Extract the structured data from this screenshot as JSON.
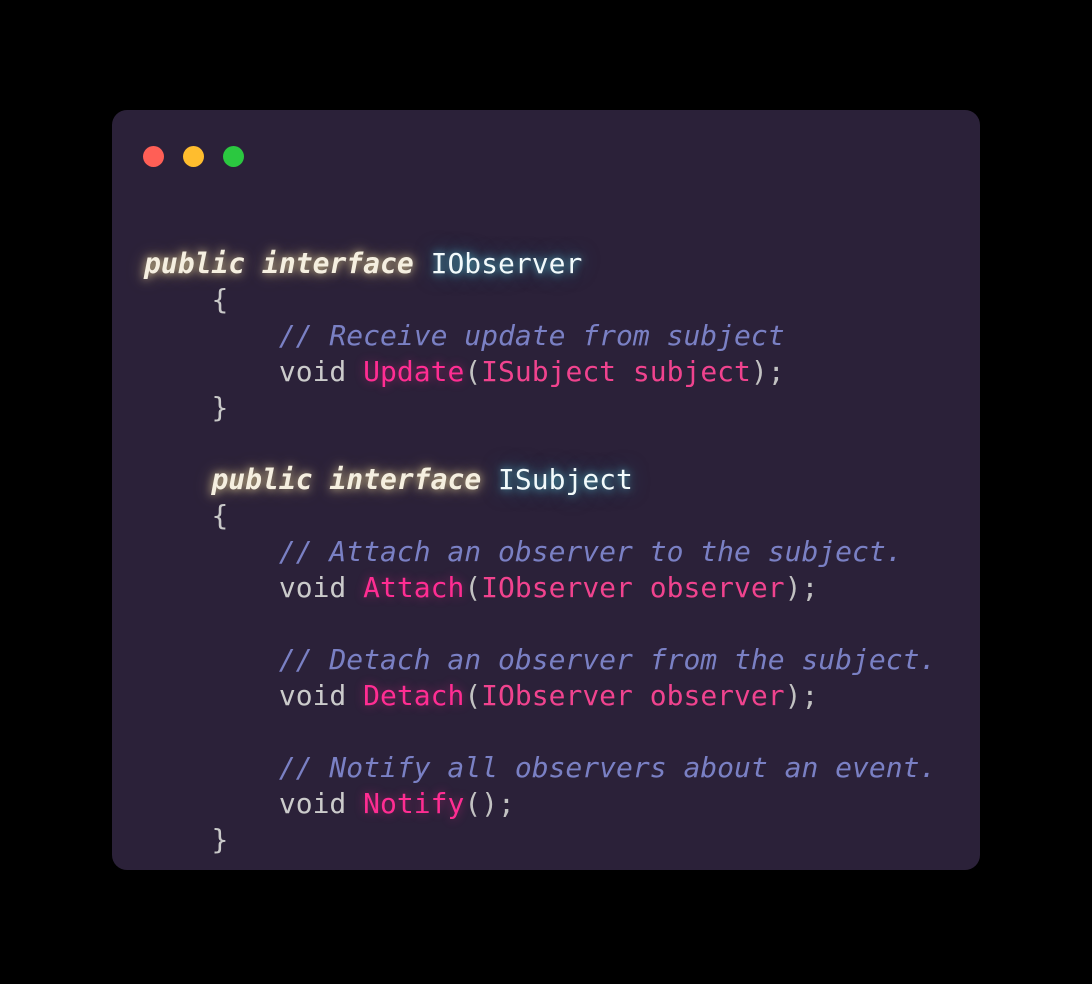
{
  "window": {
    "background_color": "#2B2139",
    "page_background_color": "#000000",
    "traffic_lights": [
      {
        "name": "close",
        "color": "#FF5F56",
        "label": ""
      },
      {
        "name": "minimize",
        "color": "#FFBD2E",
        "label": ""
      },
      {
        "name": "maximize",
        "color": "#2BC840",
        "label": ""
      }
    ]
  },
  "theme": {
    "keyword_color": "#F5EFE0",
    "type_color": "#F2FAFB",
    "comment_color": "#7A80C4",
    "plain_color": "#CBCBCB",
    "method_color": "#FF2D92",
    "param_color": "#F0438E",
    "punct_color": "#C2C2C2"
  },
  "code": {
    "language": "csharp",
    "lines": [
      {
        "n": 1,
        "indent": 0,
        "tokens": [
          {
            "t": "public",
            "k": "kw"
          },
          {
            "t": " ",
            "k": "plain"
          },
          {
            "t": "interface",
            "k": "kw"
          },
          {
            "t": " ",
            "k": "plain"
          },
          {
            "t": "IObserver",
            "k": "type"
          }
        ]
      },
      {
        "n": 2,
        "indent": 4,
        "tokens": [
          {
            "t": "{",
            "k": "brace"
          }
        ]
      },
      {
        "n": 3,
        "indent": 8,
        "tokens": [
          {
            "t": "// Receive update from subject",
            "k": "comment"
          }
        ]
      },
      {
        "n": 4,
        "indent": 8,
        "tokens": [
          {
            "t": "void",
            "k": "plain"
          },
          {
            "t": " ",
            "k": "plain"
          },
          {
            "t": "Update",
            "k": "method"
          },
          {
            "t": "(",
            "k": "punct"
          },
          {
            "t": "ISubject subject",
            "k": "param"
          },
          {
            "t": ");",
            "k": "punct"
          }
        ]
      },
      {
        "n": 5,
        "indent": 4,
        "tokens": [
          {
            "t": "}",
            "k": "brace"
          }
        ]
      },
      {
        "n": 6,
        "indent": 0,
        "tokens": []
      },
      {
        "n": 7,
        "indent": 4,
        "tokens": [
          {
            "t": "public",
            "k": "kw"
          },
          {
            "t": " ",
            "k": "plain"
          },
          {
            "t": "interface",
            "k": "kw"
          },
          {
            "t": " ",
            "k": "plain"
          },
          {
            "t": "ISubject",
            "k": "type"
          }
        ]
      },
      {
        "n": 8,
        "indent": 4,
        "tokens": [
          {
            "t": "{",
            "k": "brace"
          }
        ]
      },
      {
        "n": 9,
        "indent": 8,
        "tokens": [
          {
            "t": "// Attach an observer to the subject.",
            "k": "comment"
          }
        ]
      },
      {
        "n": 10,
        "indent": 8,
        "tokens": [
          {
            "t": "void",
            "k": "plain"
          },
          {
            "t": " ",
            "k": "plain"
          },
          {
            "t": "Attach",
            "k": "method"
          },
          {
            "t": "(",
            "k": "punct"
          },
          {
            "t": "IObserver observer",
            "k": "param"
          },
          {
            "t": ");",
            "k": "punct"
          }
        ]
      },
      {
        "n": 11,
        "indent": 0,
        "tokens": []
      },
      {
        "n": 12,
        "indent": 8,
        "tokens": [
          {
            "t": "// Detach an observer from the subject.",
            "k": "comment"
          }
        ]
      },
      {
        "n": 13,
        "indent": 8,
        "tokens": [
          {
            "t": "void",
            "k": "plain"
          },
          {
            "t": " ",
            "k": "plain"
          },
          {
            "t": "Detach",
            "k": "method"
          },
          {
            "t": "(",
            "k": "punct"
          },
          {
            "t": "IObserver observer",
            "k": "param"
          },
          {
            "t": ");",
            "k": "punct"
          }
        ]
      },
      {
        "n": 14,
        "indent": 0,
        "tokens": []
      },
      {
        "n": 15,
        "indent": 8,
        "tokens": [
          {
            "t": "// Notify all observers about an event.",
            "k": "comment"
          }
        ]
      },
      {
        "n": 16,
        "indent": 8,
        "tokens": [
          {
            "t": "void",
            "k": "plain"
          },
          {
            "t": " ",
            "k": "plain"
          },
          {
            "t": "Notify",
            "k": "method"
          },
          {
            "t": "();",
            "k": "punct"
          }
        ]
      },
      {
        "n": 17,
        "indent": 4,
        "tokens": [
          {
            "t": "}",
            "k": "brace"
          }
        ]
      }
    ]
  }
}
